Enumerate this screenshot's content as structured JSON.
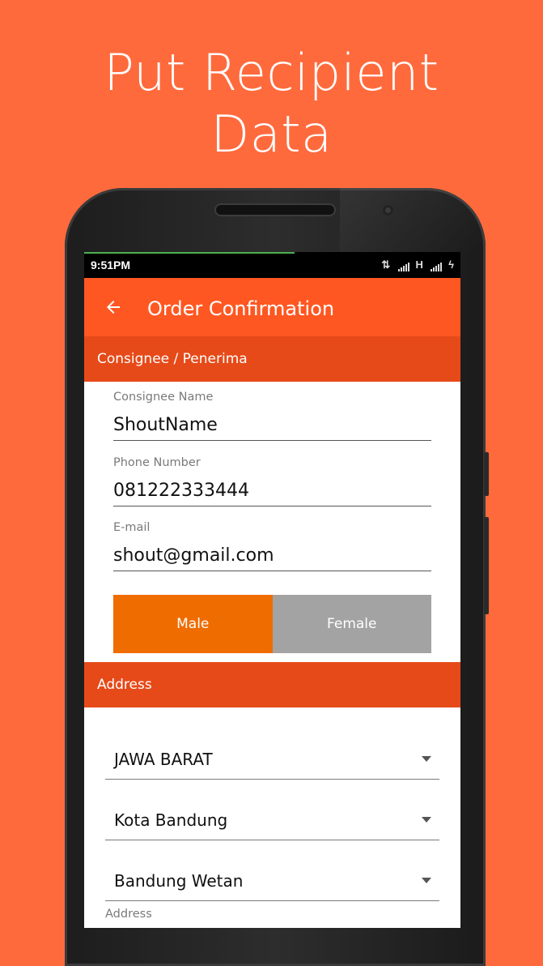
{
  "headline": {
    "line1": "Put Recipient",
    "line2": "Data"
  },
  "status_bar": {
    "time": "9:51PM",
    "network": "H"
  },
  "app_bar": {
    "title": "Order Confirmation",
    "back_icon": "arrow-left-icon"
  },
  "consignee_section": {
    "title": "Consignee / Penerima",
    "fields": [
      {
        "label": "Consignee Name",
        "value": "ShoutName"
      },
      {
        "label": "Phone Number",
        "value": "081222333444"
      },
      {
        "label": "E-mail",
        "value": "shout@gmail.com"
      }
    ],
    "gender": {
      "male": "Male",
      "female": "Female",
      "selected": "Male"
    }
  },
  "address_section": {
    "title": "Address",
    "province": "JAWA BARAT",
    "city": "Kota Bandung",
    "district": "Bandung Wetan",
    "address_label": "Address"
  },
  "colors": {
    "background": "#ff6a3d",
    "app_bar": "#ff5722",
    "section_header": "#e64a19",
    "male_selected": "#ef6c00",
    "female_unselected": "#a3a3a3"
  }
}
